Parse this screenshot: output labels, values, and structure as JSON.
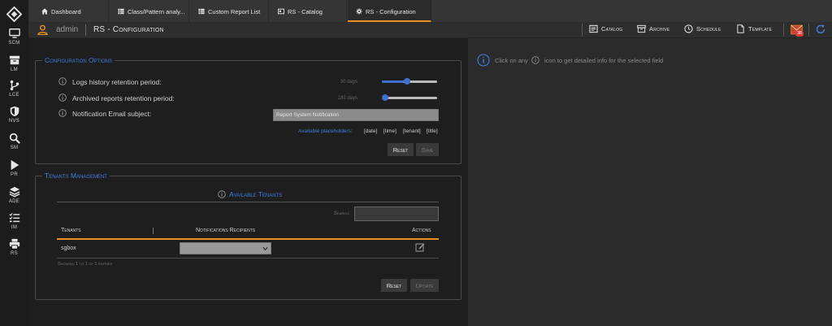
{
  "sidebar": {
    "items": [
      {
        "label": "SCM",
        "icon": "monitor-icon"
      },
      {
        "label": "LM",
        "icon": "archive-box-icon"
      },
      {
        "label": "LCE",
        "icon": "branch-icon"
      },
      {
        "label": "NVS",
        "icon": "shield-icon"
      },
      {
        "label": "SM",
        "icon": "search-icon"
      },
      {
        "label": "PR",
        "icon": "play-icon"
      },
      {
        "label": "ADE",
        "icon": "layers-icon"
      },
      {
        "label": "IM",
        "icon": "checklist-icon"
      },
      {
        "label": "RS",
        "icon": "printer-icon"
      }
    ]
  },
  "tabs": [
    {
      "label": "Dashboard",
      "icon": "home-icon"
    },
    {
      "label": "Class/Pattern analy...",
      "icon": "grid-icon"
    },
    {
      "label": "Custom Report List",
      "icon": "grid-icon"
    },
    {
      "label": "RS - Catalog",
      "icon": "card-icon"
    },
    {
      "label": "RS - Configuration",
      "icon": "gear-icon",
      "active": true
    }
  ],
  "header": {
    "username": "admin",
    "title": "RS - Configuration",
    "buttons": [
      {
        "label": "Catalog",
        "icon": "catalog-icon"
      },
      {
        "label": "Archive",
        "icon": "archive-icon"
      },
      {
        "label": "Schedule",
        "icon": "clock-icon"
      },
      {
        "label": "Template",
        "icon": "document-icon"
      }
    ],
    "mail_badge": "38"
  },
  "config": {
    "legend": "Configuration Options",
    "options": [
      {
        "label": "Logs history retention period:",
        "value_text": "30 days",
        "slider_fraction": 0.4
      },
      {
        "label": "Archived reports retention period:",
        "value_text": "180 days",
        "slider_fraction": 0.0
      },
      {
        "label": "Notification Email subject:"
      }
    ],
    "email_subject_value": "Report System Notification",
    "placeholders_label": "Available placeholders:",
    "placeholders": [
      "[date]",
      "[time]",
      "[tenant]",
      "[title]"
    ],
    "reset_label": "Reset",
    "save_label": "Save"
  },
  "tenants": {
    "legend": "Tenants Management",
    "title": "Available Tenants",
    "search_label": "Search:",
    "search_value": "",
    "columns": [
      "Tenants",
      "Notifications Recipients",
      "Actions"
    ],
    "rows": [
      {
        "tenant": "sgbox",
        "recipients": ""
      }
    ],
    "entries_info": "Showing 1 to 1 of 1 entries",
    "reset_label": "Reset",
    "update_label": "Update"
  },
  "hint": {
    "text_before": "Click on any",
    "text_after": "icon to get detailed info for the selected field"
  },
  "colors": {
    "accent": "#e8901e",
    "link": "#3d7fe0",
    "slider": "#3d6fcf",
    "badge": "#e03a3a"
  }
}
